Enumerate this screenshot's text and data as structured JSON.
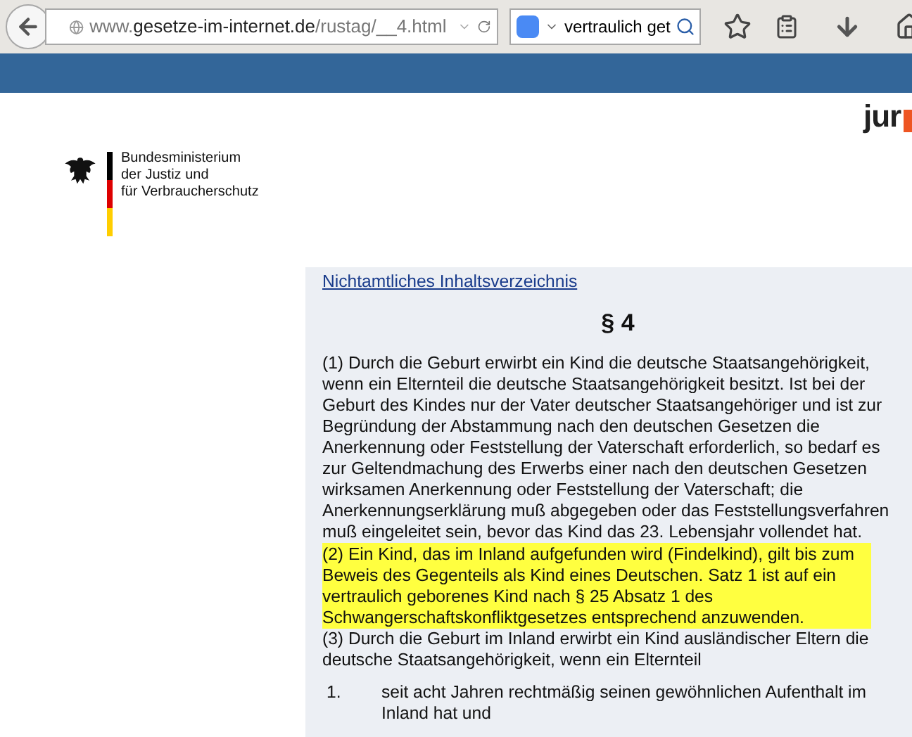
{
  "browser": {
    "url_host_prefix": "www.",
    "url_host": "gesetze-im-internet.de",
    "url_path": "/rustag/__4.html",
    "search_value": "vertraulich get"
  },
  "header": {
    "ministry_lines": [
      "Bundesministerium",
      "der Justiz und",
      "für Verbraucherschutz"
    ],
    "logo_text": "jur"
  },
  "content": {
    "toc_link": "Nichtamtliches Inhaltsverzeichnis",
    "heading": "§ 4",
    "paragraphs": [
      {
        "text": "(1) Durch die Geburt erwirbt ein Kind die deutsche Staatsangehörigkeit, wenn ein Elternteil die deutsche Staatsangehörigkeit besitzt. Ist bei der Geburt des Kindes nur der Vater deutscher Staatsangehöriger und ist zur Begründung der Abstammung nach den deutschen Gesetzen die Anerkennung oder Feststellung der Vaterschaft erforderlich, so bedarf es zur Geltendmachung des Erwerbs einer nach den deutschen Gesetzen wirksamen Anerkennung oder Feststellung der Vaterschaft; die Anerkennungserklärung muß abgegeben oder das Feststellungsverfahren muß eingeleitet sein, bevor das Kind das 23. Lebensjahr vollendet hat.",
        "highlighted": false
      },
      {
        "text": "(2) Ein Kind, das im Inland aufgefunden wird (Findelkind), gilt bis zum Beweis des Gegenteils als Kind eines Deutschen. Satz 1 ist auf ein vertraulich geborenes Kind nach § 25 Absatz 1 des Schwangerschaftskonfliktgesetzes entsprechend anzuwenden.",
        "highlighted": true
      },
      {
        "text": "(3) Durch die Geburt im Inland erwirbt ein Kind ausländischer Eltern die deutsche Staatsangehörigkeit, wenn ein Elternteil",
        "highlighted": false
      }
    ],
    "list_items": [
      {
        "number": "1.",
        "text": "seit acht Jahren rechtmäßig seinen gewöhnlichen Aufenthalt im Inland hat und"
      }
    ]
  }
}
